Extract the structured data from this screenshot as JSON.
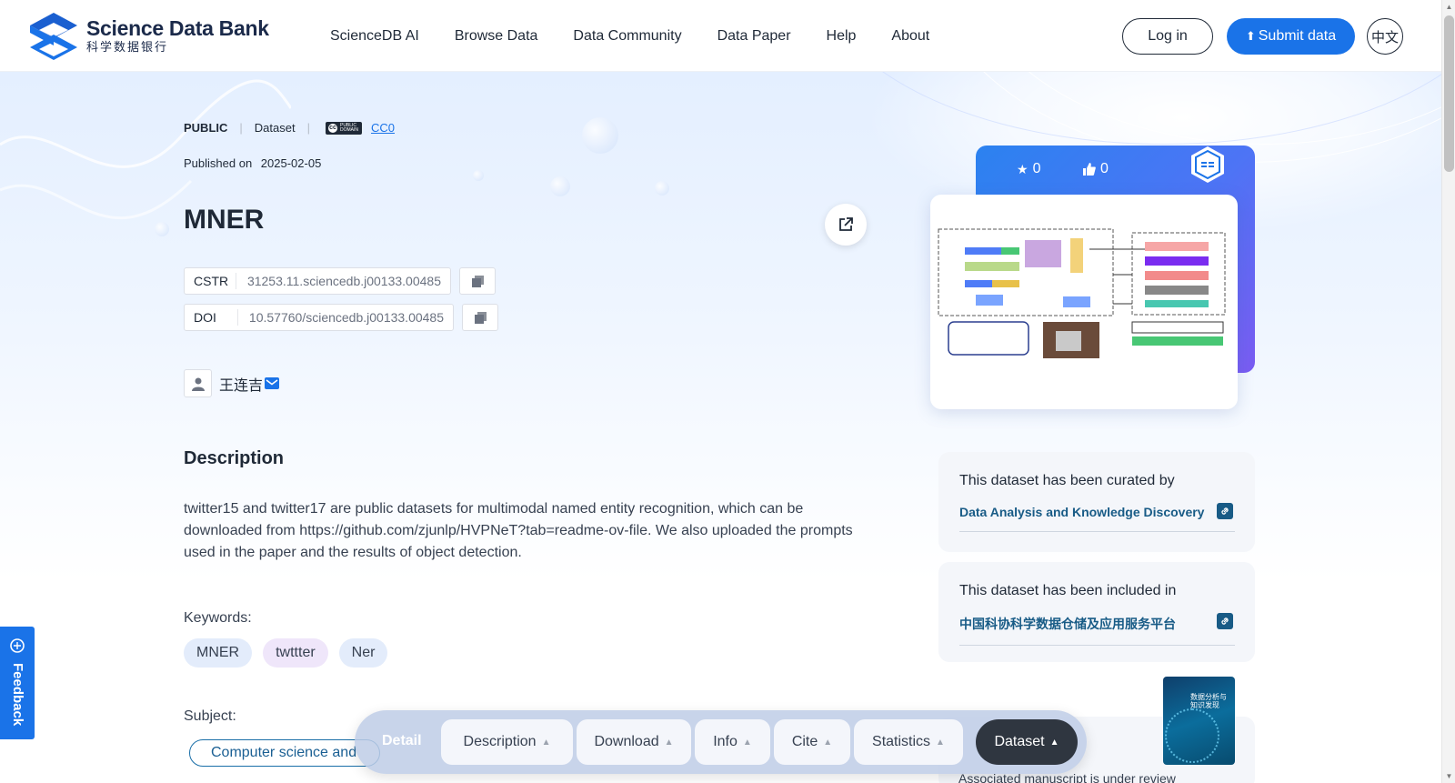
{
  "header": {
    "logo_en": "Science Data Bank",
    "logo_cn": "科学数据银行",
    "nav": [
      "ScienceDB AI",
      "Browse Data",
      "Data Community",
      "Data Paper",
      "Help",
      "About"
    ],
    "login": "Log in",
    "submit": "Submit data",
    "lang": "中文"
  },
  "dataset": {
    "access": "PUBLIC",
    "type": "Dataset",
    "license": "CC0",
    "published_label": "Published on",
    "published_date": "2025-02-05",
    "title": "MNER",
    "cstr_label": "CSTR",
    "cstr": "31253.11.sciencedb.j00133.00485",
    "doi_label": "DOI",
    "doi": "10.57760/sciencedb.j00133.00485",
    "author": "王连吉"
  },
  "description": {
    "heading": "Description",
    "text": "twitter15 and twitter17 are public datasets for multimodal named entity recognition, which can be downloaded from https://github.com/zjunlp/HVPNeT?tab=readme-ov-file. We also uploaded the prompts used in the paper and the results of object detection."
  },
  "keywords": {
    "label": "Keywords:",
    "items": [
      "MNER",
      "twttter",
      "Ner"
    ]
  },
  "subject": {
    "label": "Subject:",
    "value": "Computer science and"
  },
  "stats": {
    "stars": "0",
    "likes": "0"
  },
  "curated": {
    "heading": "This dataset has been curated by",
    "link": "Data Analysis and Knowledge Discovery"
  },
  "included": {
    "heading": "This dataset has been included in",
    "link": "中国科协科学数据仓储及应用服务平台"
  },
  "journal": {
    "note": "Associated manuscript is under review",
    "cover_title": "数据分析与知识发现"
  },
  "feedback": "Feedback",
  "floatbar": {
    "detail": "Detail",
    "tabs": [
      "Description",
      "Download",
      "Info",
      "Cite",
      "Statistics",
      "Dataset"
    ]
  },
  "colors": {
    "primary": "#1a73e8",
    "link": "#185b86",
    "active_tab": "#2f3640"
  }
}
